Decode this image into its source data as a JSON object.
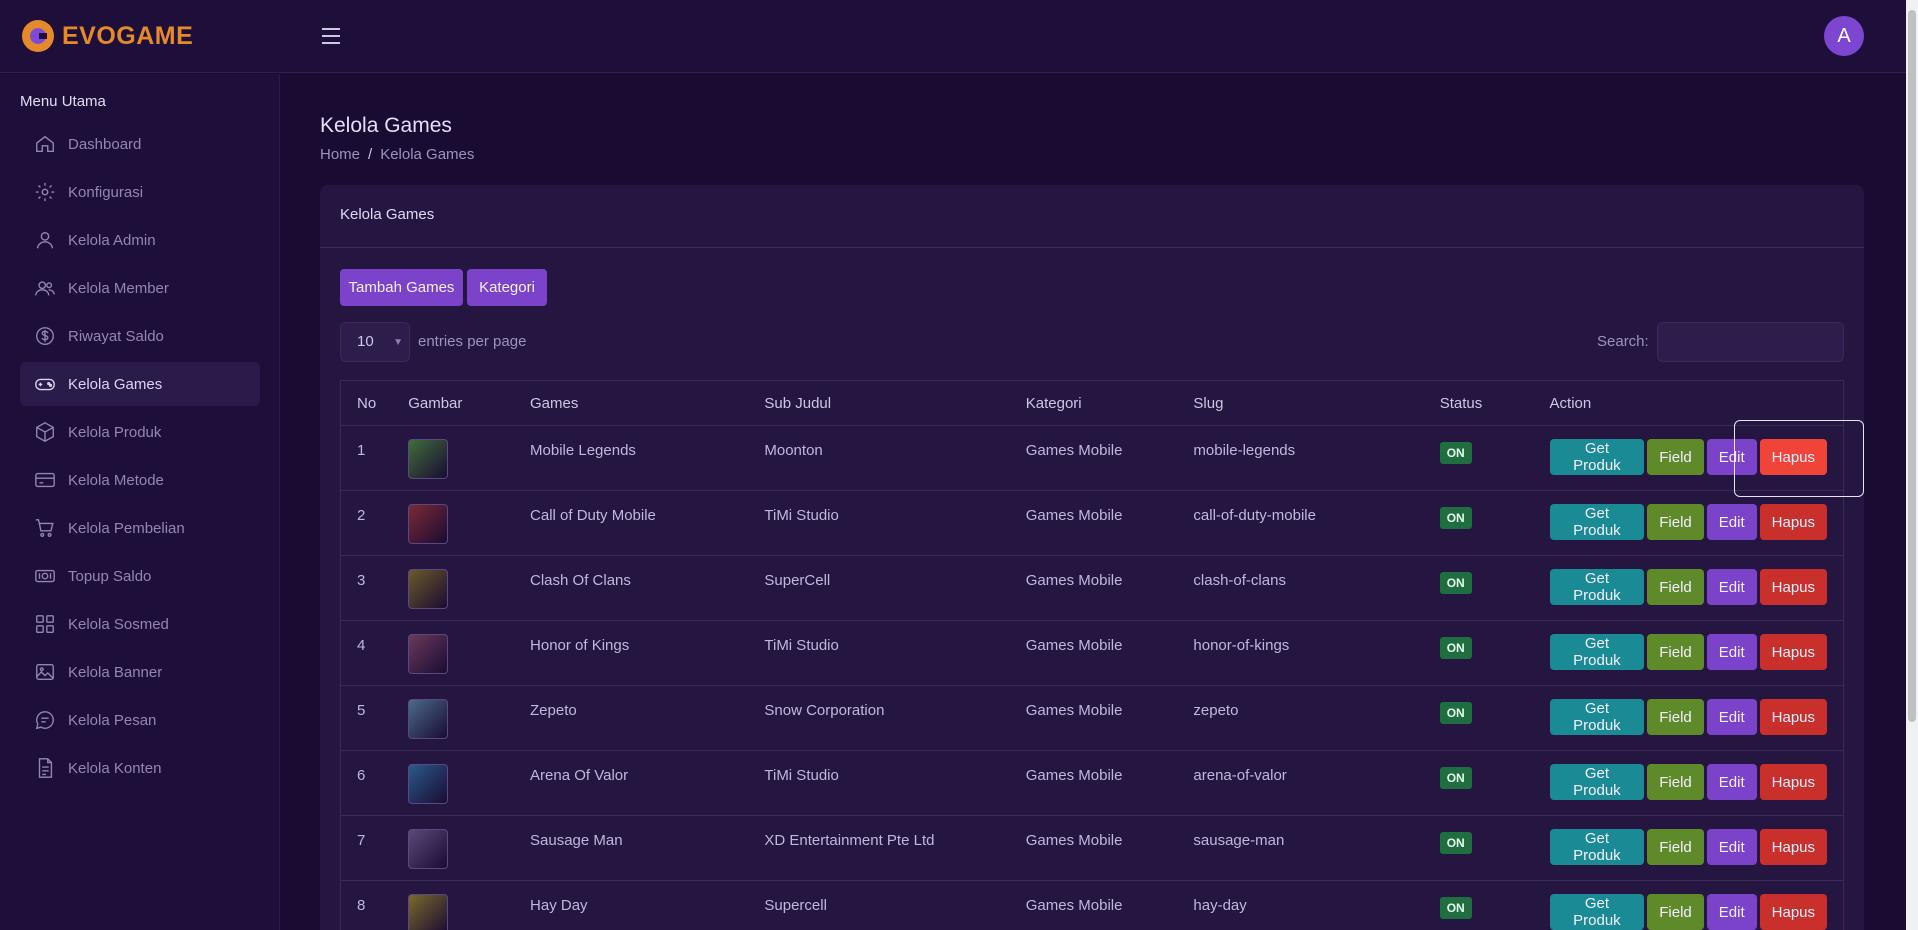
{
  "brand": {
    "name": "EVOGAME"
  },
  "user": {
    "avatar_letter": "A"
  },
  "sidebar": {
    "title": "Menu Utama",
    "items": [
      {
        "label": "Dashboard",
        "icon": "home-icon"
      },
      {
        "label": "Konfigurasi",
        "icon": "gear-icon"
      },
      {
        "label": "Kelola Admin",
        "icon": "user-icon"
      },
      {
        "label": "Kelola Member",
        "icon": "users-icon"
      },
      {
        "label": "Riwayat Saldo",
        "icon": "dollar-icon"
      },
      {
        "label": "Kelola Games",
        "icon": "gamepad-icon",
        "active": true
      },
      {
        "label": "Kelola Produk",
        "icon": "box-icon"
      },
      {
        "label": "Kelola Metode",
        "icon": "card-icon"
      },
      {
        "label": "Kelola Pembelian",
        "icon": "cart-icon"
      },
      {
        "label": "Topup Saldo",
        "icon": "money-icon"
      },
      {
        "label": "Kelola Sosmed",
        "icon": "grid-icon"
      },
      {
        "label": "Kelola Banner",
        "icon": "image-icon"
      },
      {
        "label": "Kelola Pesan",
        "icon": "chat-icon"
      },
      {
        "label": "Kelola Konten",
        "icon": "document-icon"
      }
    ]
  },
  "page": {
    "title": "Kelola Games",
    "breadcrumb": [
      "Home",
      "Kelola Games"
    ]
  },
  "card": {
    "title": "Kelola Games",
    "buttons": {
      "add": "Tambah Games",
      "category": "Kategori"
    },
    "entries": {
      "value": "10",
      "label": "entries per page"
    },
    "search": {
      "label": "Search:"
    }
  },
  "table": {
    "headers": [
      "No",
      "Gambar",
      "Games",
      "Sub Judul",
      "Kategori",
      "Slug",
      "Status",
      "Action"
    ],
    "action_labels": {
      "get": "Get Produk",
      "field": "Field",
      "edit": "Edit",
      "delete": "Hapus"
    },
    "rows": [
      {
        "no": "1",
        "game": "Mobile Legends",
        "sub": "Moonton",
        "category": "Games Mobile",
        "slug": "mobile-legends",
        "status": "ON",
        "color": "#3f6d3a"
      },
      {
        "no": "2",
        "game": "Call of Duty Mobile",
        "sub": "TiMi Studio",
        "category": "Games Mobile",
        "slug": "call-of-duty-mobile",
        "status": "ON",
        "color": "#7a2a35"
      },
      {
        "no": "3",
        "game": "Clash Of Clans",
        "sub": "SuperCell",
        "category": "Games Mobile",
        "slug": "clash-of-clans",
        "status": "ON",
        "color": "#6b5a2a"
      },
      {
        "no": "4",
        "game": "Honor of Kings",
        "sub": "TiMi Studio",
        "category": "Games Mobile",
        "slug": "honor-of-kings",
        "status": "ON",
        "color": "#6a3a5a"
      },
      {
        "no": "5",
        "game": "Zepeto",
        "sub": "Snow Corporation",
        "category": "Games Mobile",
        "slug": "zepeto",
        "status": "ON",
        "color": "#4a6a8a"
      },
      {
        "no": "6",
        "game": "Arena Of Valor",
        "sub": "TiMi Studio",
        "category": "Games Mobile",
        "slug": "arena-of-valor",
        "status": "ON",
        "color": "#2a5a8a"
      },
      {
        "no": "7",
        "game": "Sausage Man",
        "sub": "XD Entertainment Pte Ltd",
        "category": "Games Mobile",
        "slug": "sausage-man",
        "status": "ON",
        "color": "#5a4a7a"
      },
      {
        "no": "8",
        "game": "Hay Day",
        "sub": "Supercell",
        "category": "Games Mobile",
        "slug": "hay-day",
        "status": "ON",
        "color": "#7a6a2a"
      }
    ]
  }
}
